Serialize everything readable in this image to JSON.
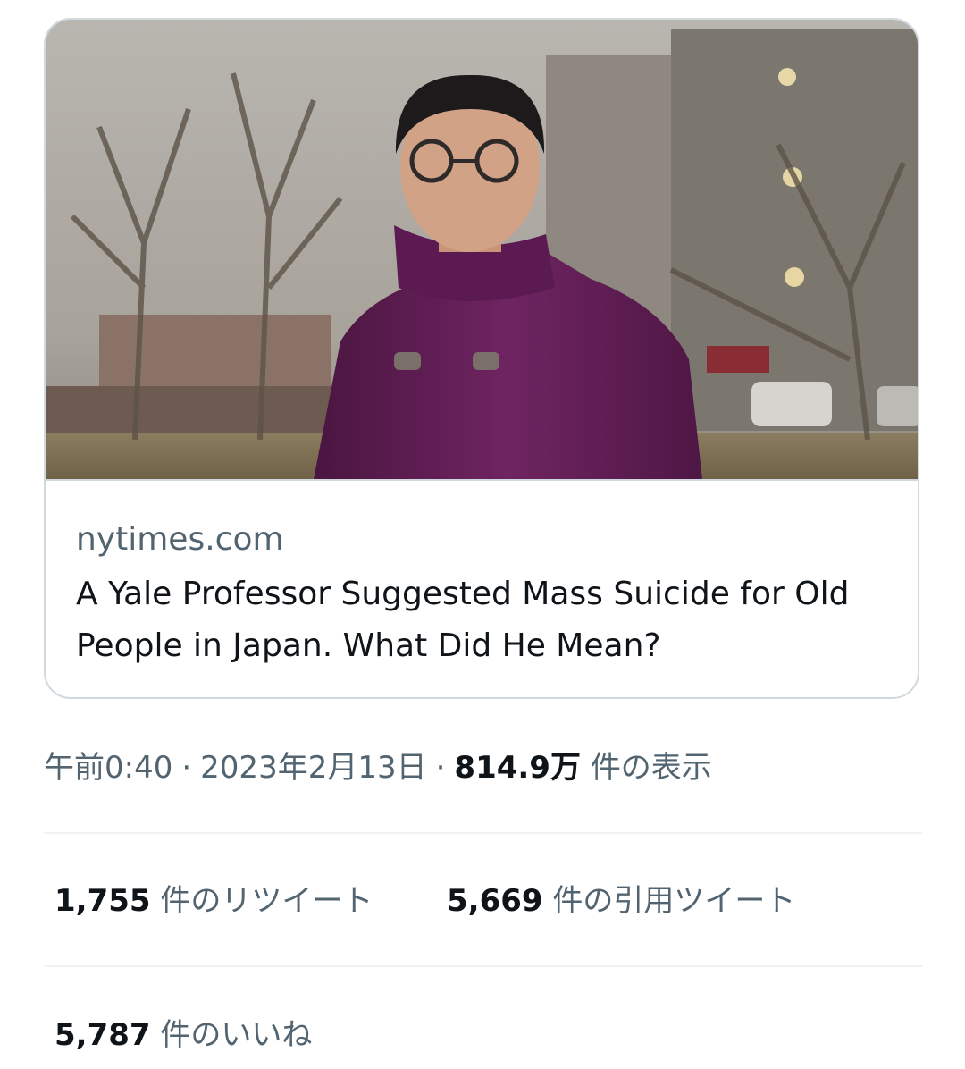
{
  "link_card": {
    "domain": "nytimes.com",
    "title": "A Yale Professor Suggested Mass Suicide for Old People in Japan. What Did He Mean?",
    "image_alt": "photo of man in purple knit jacket and round glasses in a park"
  },
  "tweet_meta": {
    "time": "午前0:40",
    "separator": "·",
    "date": "2023年2月13日",
    "views_count": "814.9万",
    "views_label": "件の表示"
  },
  "stats": {
    "retweets": {
      "count": "1,755",
      "label": "件のリツイート"
    },
    "quotes": {
      "count": "5,669",
      "label": "件の引用ツイート"
    },
    "likes": {
      "count": "5,787",
      "label": "件のいいね"
    }
  },
  "colors": {
    "text_primary": "#0f1419",
    "text_secondary": "#536471",
    "border": "#cfd9de",
    "divider": "#eff3f4"
  }
}
